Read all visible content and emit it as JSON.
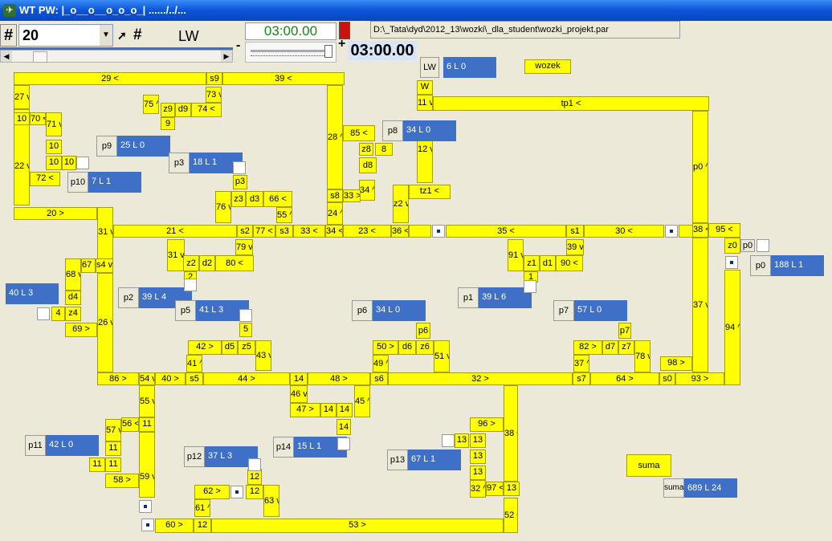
{
  "title": "WT PW: |_o__o__o_o_o_| ....../../...",
  "toolbar": {
    "hash_label": "#",
    "speed_value": "20",
    "hash2_label": "#",
    "mode_label": "LW",
    "timer_top": "03:00.00",
    "minus_label": "-",
    "plus_label": "+",
    "timer_main": "03:00.00"
  },
  "file_path": "D:\\_Tata\\dyd\\2012_13\\wozki\\_dla_student\\wozki_projekt.par",
  "lw": {
    "label": "LW",
    "value": "6 L 0"
  },
  "wozek_label": "wozek",
  "suma": {
    "button_label": "suma",
    "label": "suma",
    "value": "689 L 24"
  },
  "track_labels": {
    "t29": "29 <",
    "ts9": "s9",
    "t39": "39 <",
    "t27": "27 v",
    "t73": "73 v",
    "t75": "75 ^",
    "tz9": "z9",
    "td9": "d9",
    "t74": "74 <",
    "t10a": "10",
    "t70": "70 <",
    "t71": "71 v",
    "t10b": "10",
    "t22": "22 v",
    "t10c": "10",
    "t10d": "10",
    "t10e": "10",
    "t72": "72 <",
    "t20": "20 >",
    "t9": "9",
    "t28": "28 ^",
    "t85": "85 <",
    "tz8": "z8",
    "t8b": "8",
    "td8": "d8",
    "t34a": "34 ^",
    "ts8": "s8",
    "t33a": "33 >",
    "t24": "24 ^",
    "tw": "W",
    "t11": "11 v",
    "t12": "12 v",
    "ttz1": "tz1 <",
    "tz2": "z2 v",
    "ttp1": "tp1 <",
    "tp0": "p0 ^",
    "tz3": "z3",
    "td3": "d3",
    "t66": "66 <",
    "t55": "55 ^",
    "t76": "76 v",
    "tp3": "p3",
    "t21": "21 <",
    "t31a": "31 v",
    "ts2": "s2",
    "t77": "77 <",
    "ts3": "s3",
    "t33b": "33 <",
    "t34b": "34 <",
    "t23": "23 <",
    "t36": "36 <",
    "t35": "35 <",
    "ts1": "s1",
    "t30": "30 <",
    "t38a": "38 <",
    "t95": "95 <",
    "tz0": "z0",
    "t67": "67 <",
    "ts4": "s4 v",
    "t68": "68 v",
    "td4": "d4",
    "tz4": "z4",
    "t4": "4",
    "t69": "69 >",
    "t26": "26 v",
    "t31b": "31 v",
    "tz2b": "z2",
    "td2": "d2",
    "t80": "80 <",
    "t2": "2",
    "t79": "79 v",
    "t91": "91 v",
    "tz1": "z1",
    "td1": "d1",
    "t90": "90 <",
    "t1": "1",
    "t39b": "39 v",
    "t37a": "37 v",
    "t94": "94 ^",
    "t5": "5",
    "tp5": "p5",
    "t42": "42 >",
    "td5": "d5",
    "tz5": "z5",
    "t43": "43 v",
    "t41": "41 ^",
    "t50": "50 >",
    "td6": "d6",
    "tz6": "z6",
    "t51": "51 v",
    "tp6": "p6",
    "t49": "49 ^",
    "t82": "82 >",
    "td7": "d7",
    "tz7": "z7",
    "t78": "78 v",
    "tp7": "p7",
    "t37b": "37 ^",
    "t98": "98 >",
    "t86": "86 >",
    "t54": "54 v",
    "t40": "40 >",
    "ts5": "s5",
    "t44": "44 >",
    "t14a": "14",
    "t48": "48 >",
    "ts6": "s6",
    "t32": "32 >",
    "ts7": "s7",
    "t64": "64 >",
    "ts0": "s0",
    "t93": "93 >",
    "t46": "46 v",
    "t45": "45 ^",
    "t47": "47 >",
    "t14b": "14",
    "t14c": "14",
    "t14d": "14",
    "t55b": "55 v",
    "t56": "56 <",
    "t11b": "11",
    "t57": "57 v",
    "t11c": "11",
    "t11d": "11",
    "t11e": "11",
    "t58": "58 >",
    "t59": "59 v",
    "t96": "96 >",
    "t13a": "13",
    "t13b": "13",
    "t13c": "13",
    "t13d": "13",
    "t38b": "38 ^",
    "t32b": "32 ^",
    "t97": "97 <",
    "t13e": "13",
    "t12b": "12",
    "t12c": "12",
    "t62": "62 >",
    "t63": "63 v",
    "t61": "61 ^",
    "t60": "60 >",
    "t12d": "12",
    "t53": "53 >",
    "t52": "52 ^"
  },
  "stations": [
    {
      "label": "p9",
      "value": "25 L 0"
    },
    {
      "label": "p3",
      "value": "18 L 1"
    },
    {
      "label": "p10",
      "value": "7 L 1"
    },
    {
      "label": "p8",
      "value": "34 L 0"
    },
    {
      "label": "p0",
      "value": "188 L 1"
    },
    {
      "label": "",
      "value": "40 L 3"
    },
    {
      "label": "p2",
      "value": "39 L 4"
    },
    {
      "label": "p5",
      "value": "41 L 3"
    },
    {
      "label": "p6",
      "value": "34 L 0"
    },
    {
      "label": "p1",
      "value": "39 L 6"
    },
    {
      "label": "p7",
      "value": "57 L 0"
    },
    {
      "label": "p11",
      "value": "42 L 0"
    },
    {
      "label": "p12",
      "value": "37 L 3"
    },
    {
      "label": "p14",
      "value": "15 L 1"
    },
    {
      "label": "p13",
      "value": "67 L 1"
    }
  ],
  "p0_small_label": "p0",
  "colors": {
    "track": "#ffff00",
    "station_value": "#3f70c7",
    "title_bar": "#0a54d8",
    "timer_text": "#128812",
    "indicator": "#d01010"
  }
}
